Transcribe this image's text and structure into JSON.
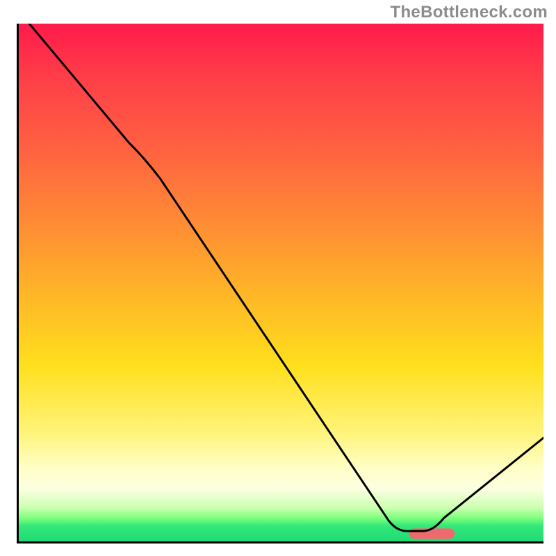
{
  "watermark": "TheBottleneck.com",
  "chart_data": {
    "type": "line",
    "title": "",
    "xlabel": "",
    "ylabel": "",
    "xlim": [
      0,
      100
    ],
    "ylim": [
      0,
      100
    ],
    "series": [
      {
        "name": "bottleneck-curve",
        "x": [
          2,
          22,
          72,
          78,
          100
        ],
        "values": [
          100,
          76,
          2,
          2,
          20
        ]
      }
    ],
    "gradient": {
      "top": "#ff1a4b",
      "mid": "#ffdf1c",
      "bottom": "#20db76"
    },
    "marker": {
      "name": "optimal-range",
      "x_start": 74.4,
      "x_end": 83.1,
      "y": 1.5,
      "color": "#ef6a6f"
    }
  }
}
